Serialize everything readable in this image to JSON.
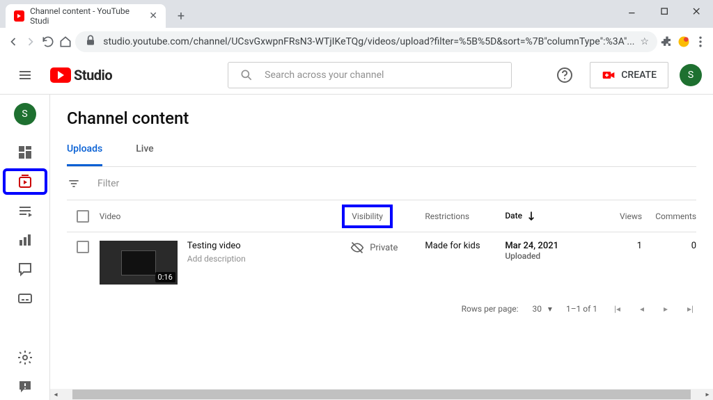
{
  "browser": {
    "tab_title": "Channel content - YouTube Studi",
    "url": "studio.youtube.com/channel/UCsvGxwpnFRsN3-WTjIKeTQg/videos/upload?filter=%5B%5D&sort=%7B\"columnType\":%3A\"..."
  },
  "header": {
    "logo_text": "Studio",
    "search_placeholder": "Search across your channel",
    "create_label": "CREATE",
    "avatar_initial": "S"
  },
  "sidebar": {
    "avatar_initial": "S"
  },
  "page": {
    "title": "Channel content",
    "tabs": {
      "uploads": "Uploads",
      "live": "Live"
    },
    "filter_label": "Filter"
  },
  "columns": {
    "video": "Video",
    "visibility": "Visibility",
    "restrictions": "Restrictions",
    "date": "Date",
    "views": "Views",
    "comments": "Comments"
  },
  "rows": [
    {
      "duration": "0:16",
      "title": "Testing video",
      "description": "Add description",
      "visibility": "Private",
      "restrictions": "Made for kids",
      "date": "Mar 24, 2021",
      "date_sub": "Uploaded",
      "views": "1",
      "comments": "0"
    }
  ],
  "pagination": {
    "rows_label": "Rows per page:",
    "rows_value": "30",
    "range": "1–1 of 1"
  }
}
